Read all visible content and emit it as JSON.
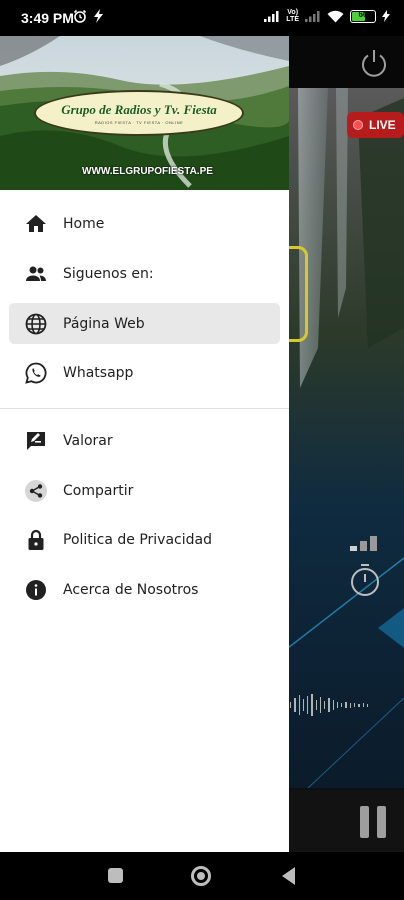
{
  "status_bar": {
    "time": "3:49 PM",
    "volte_top": "Vo)",
    "volte_bottom": "LTE",
    "battery_level": "60"
  },
  "app": {
    "live_label": "LIVE",
    "progress_fraction": 0.6
  },
  "drawer": {
    "header": {
      "logo_title": "Grupo de Radios y Tv. Fiesta",
      "logo_subtitle": "RADIOS FIESTA · TV FIESTA · ONLINE",
      "url": "WWW.ELGRUPOFIESTA.PE"
    },
    "items": [
      {
        "label": "Home",
        "icon": "home-icon"
      },
      {
        "label": "Siguenos en:",
        "icon": "people-icon"
      },
      {
        "label": "Página Web",
        "icon": "globe-icon",
        "active": true
      },
      {
        "label": "Whatsapp",
        "icon": "whatsapp-icon"
      },
      {
        "label": "Valorar",
        "icon": "rate-review-icon"
      },
      {
        "label": "Compartir",
        "icon": "share-icon"
      },
      {
        "label": "Politica de Privacidad",
        "icon": "lock-icon"
      },
      {
        "label": "Acerca de Nosotros",
        "icon": "info-icon"
      }
    ]
  },
  "colors": {
    "accent_live": "#b71c1c",
    "active_item_bg": "#e8e8e8",
    "frame_yellow": "#d9c82d"
  }
}
